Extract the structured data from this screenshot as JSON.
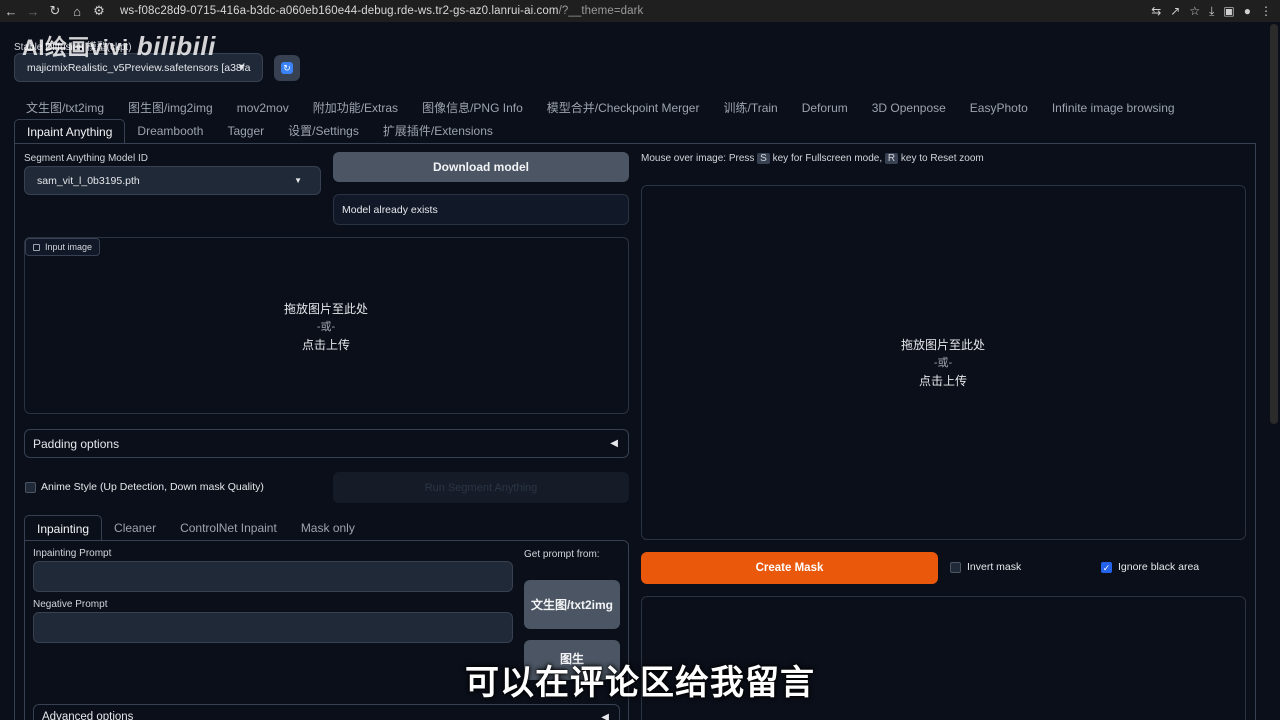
{
  "browser": {
    "url_main": "ws-f08c28d9-0715-416a-b3dc-a060eb160e44-debug.rde-ws.tr2-gs-az0.lanrui-ai.com",
    "url_rest": "/?__theme=dark"
  },
  "watermark": {
    "text": "AI绘画vivi",
    "logo": "bilibili"
  },
  "checkpoint": {
    "label": "Stable Diffusion 模型(ckpt)",
    "value": "majicmixRealistic_v5Preview.safetensors [a38fa"
  },
  "tabs_row1": [
    "文生图/txt2img",
    "图生图/img2img",
    "mov2mov",
    "附加功能/Extras",
    "图像信息/PNG Info",
    "模型合并/Checkpoint Merger",
    "训练/Train",
    "Deforum",
    "3D Openpose",
    "EasyPhoto",
    "Infinite image browsing"
  ],
  "tabs_row2": [
    "Inpaint Anything",
    "Dreambooth",
    "Tagger",
    "设置/Settings",
    "扩展插件/Extensions"
  ],
  "left": {
    "sam_label": "Segment Anything Model ID",
    "sam_value": "sam_vit_l_0b3195.pth",
    "download_btn": "Download model",
    "status": "Model already exists",
    "input_chip": "Input image",
    "drop_line1": "拖放图片至此处",
    "drop_or": "-或-",
    "drop_line2": "点击上传",
    "padding_options": "Padding options",
    "anime_style": "Anime Style (Up Detection, Down mask Quality)",
    "run_sam": "Run Segment Anything",
    "subtabs": [
      "Inpainting",
      "Cleaner",
      "ControlNet Inpaint",
      "Mask only"
    ],
    "inpainting_prompt": "Inpainting Prompt",
    "negative_prompt": "Negative Prompt",
    "get_prompt_from": "Get prompt from:",
    "btn_txt2img": "文生图/txt2img",
    "btn_img2img": "图生",
    "advanced_options": "Advanced options"
  },
  "right": {
    "hint_pre": "Mouse over image: Press ",
    "hint_key1": "S",
    "hint_mid": " key for Fullscreen mode, ",
    "hint_key2": "R",
    "hint_post": " key to Reset zoom",
    "drop_line1": "拖放图片至此处",
    "drop_or": "-或-",
    "drop_line2": "点击上传",
    "create_mask": "Create Mask",
    "invert_mask": "Invert mask",
    "ignore_black": "Ignore black area"
  },
  "subtitle": "可以在评论区给我留言",
  "colors": {
    "accent_orange": "#ea580c",
    "checkbox_blue": "#2563eb",
    "bg": "#0b0f19"
  }
}
